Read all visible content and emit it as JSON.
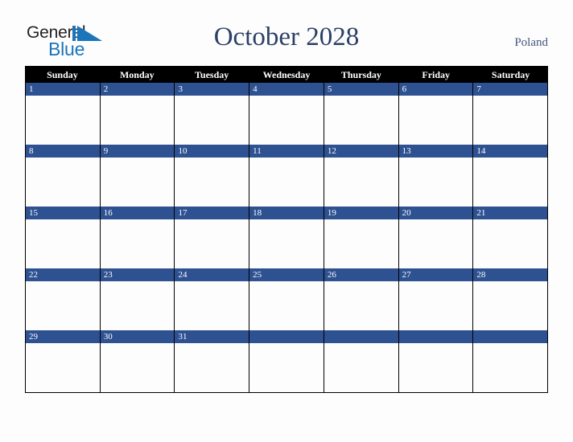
{
  "brand": {
    "word_one": "General",
    "word_two": "Blue",
    "mark_icon": "triangle-play-icon",
    "mark_color": "#1a75bb",
    "word_one_color": "#231f20",
    "word_two_color": "#1a75bb"
  },
  "header": {
    "title": "October 2028",
    "country": "Poland",
    "title_color": "#2b3f66",
    "country_color": "#44557e"
  },
  "calendar": {
    "day_headers": [
      "Sunday",
      "Monday",
      "Tuesday",
      "Wednesday",
      "Thursday",
      "Friday",
      "Saturday"
    ],
    "header_bg": "#000000",
    "header_text_color": "#ffffff",
    "date_band_color": "#2e5191",
    "date_text_color": "#ffffff",
    "cell_bg": "#fdfdfd",
    "grid_line_color": "#000000",
    "weeks": [
      [
        "1",
        "2",
        "3",
        "4",
        "5",
        "6",
        "7"
      ],
      [
        "8",
        "9",
        "10",
        "11",
        "12",
        "13",
        "14"
      ],
      [
        "15",
        "16",
        "17",
        "18",
        "19",
        "20",
        "21"
      ],
      [
        "22",
        "23",
        "24",
        "25",
        "26",
        "27",
        "28"
      ],
      [
        "29",
        "30",
        "31",
        "",
        "",
        "",
        ""
      ]
    ]
  },
  "page": {
    "background": "#fdfdfd"
  }
}
